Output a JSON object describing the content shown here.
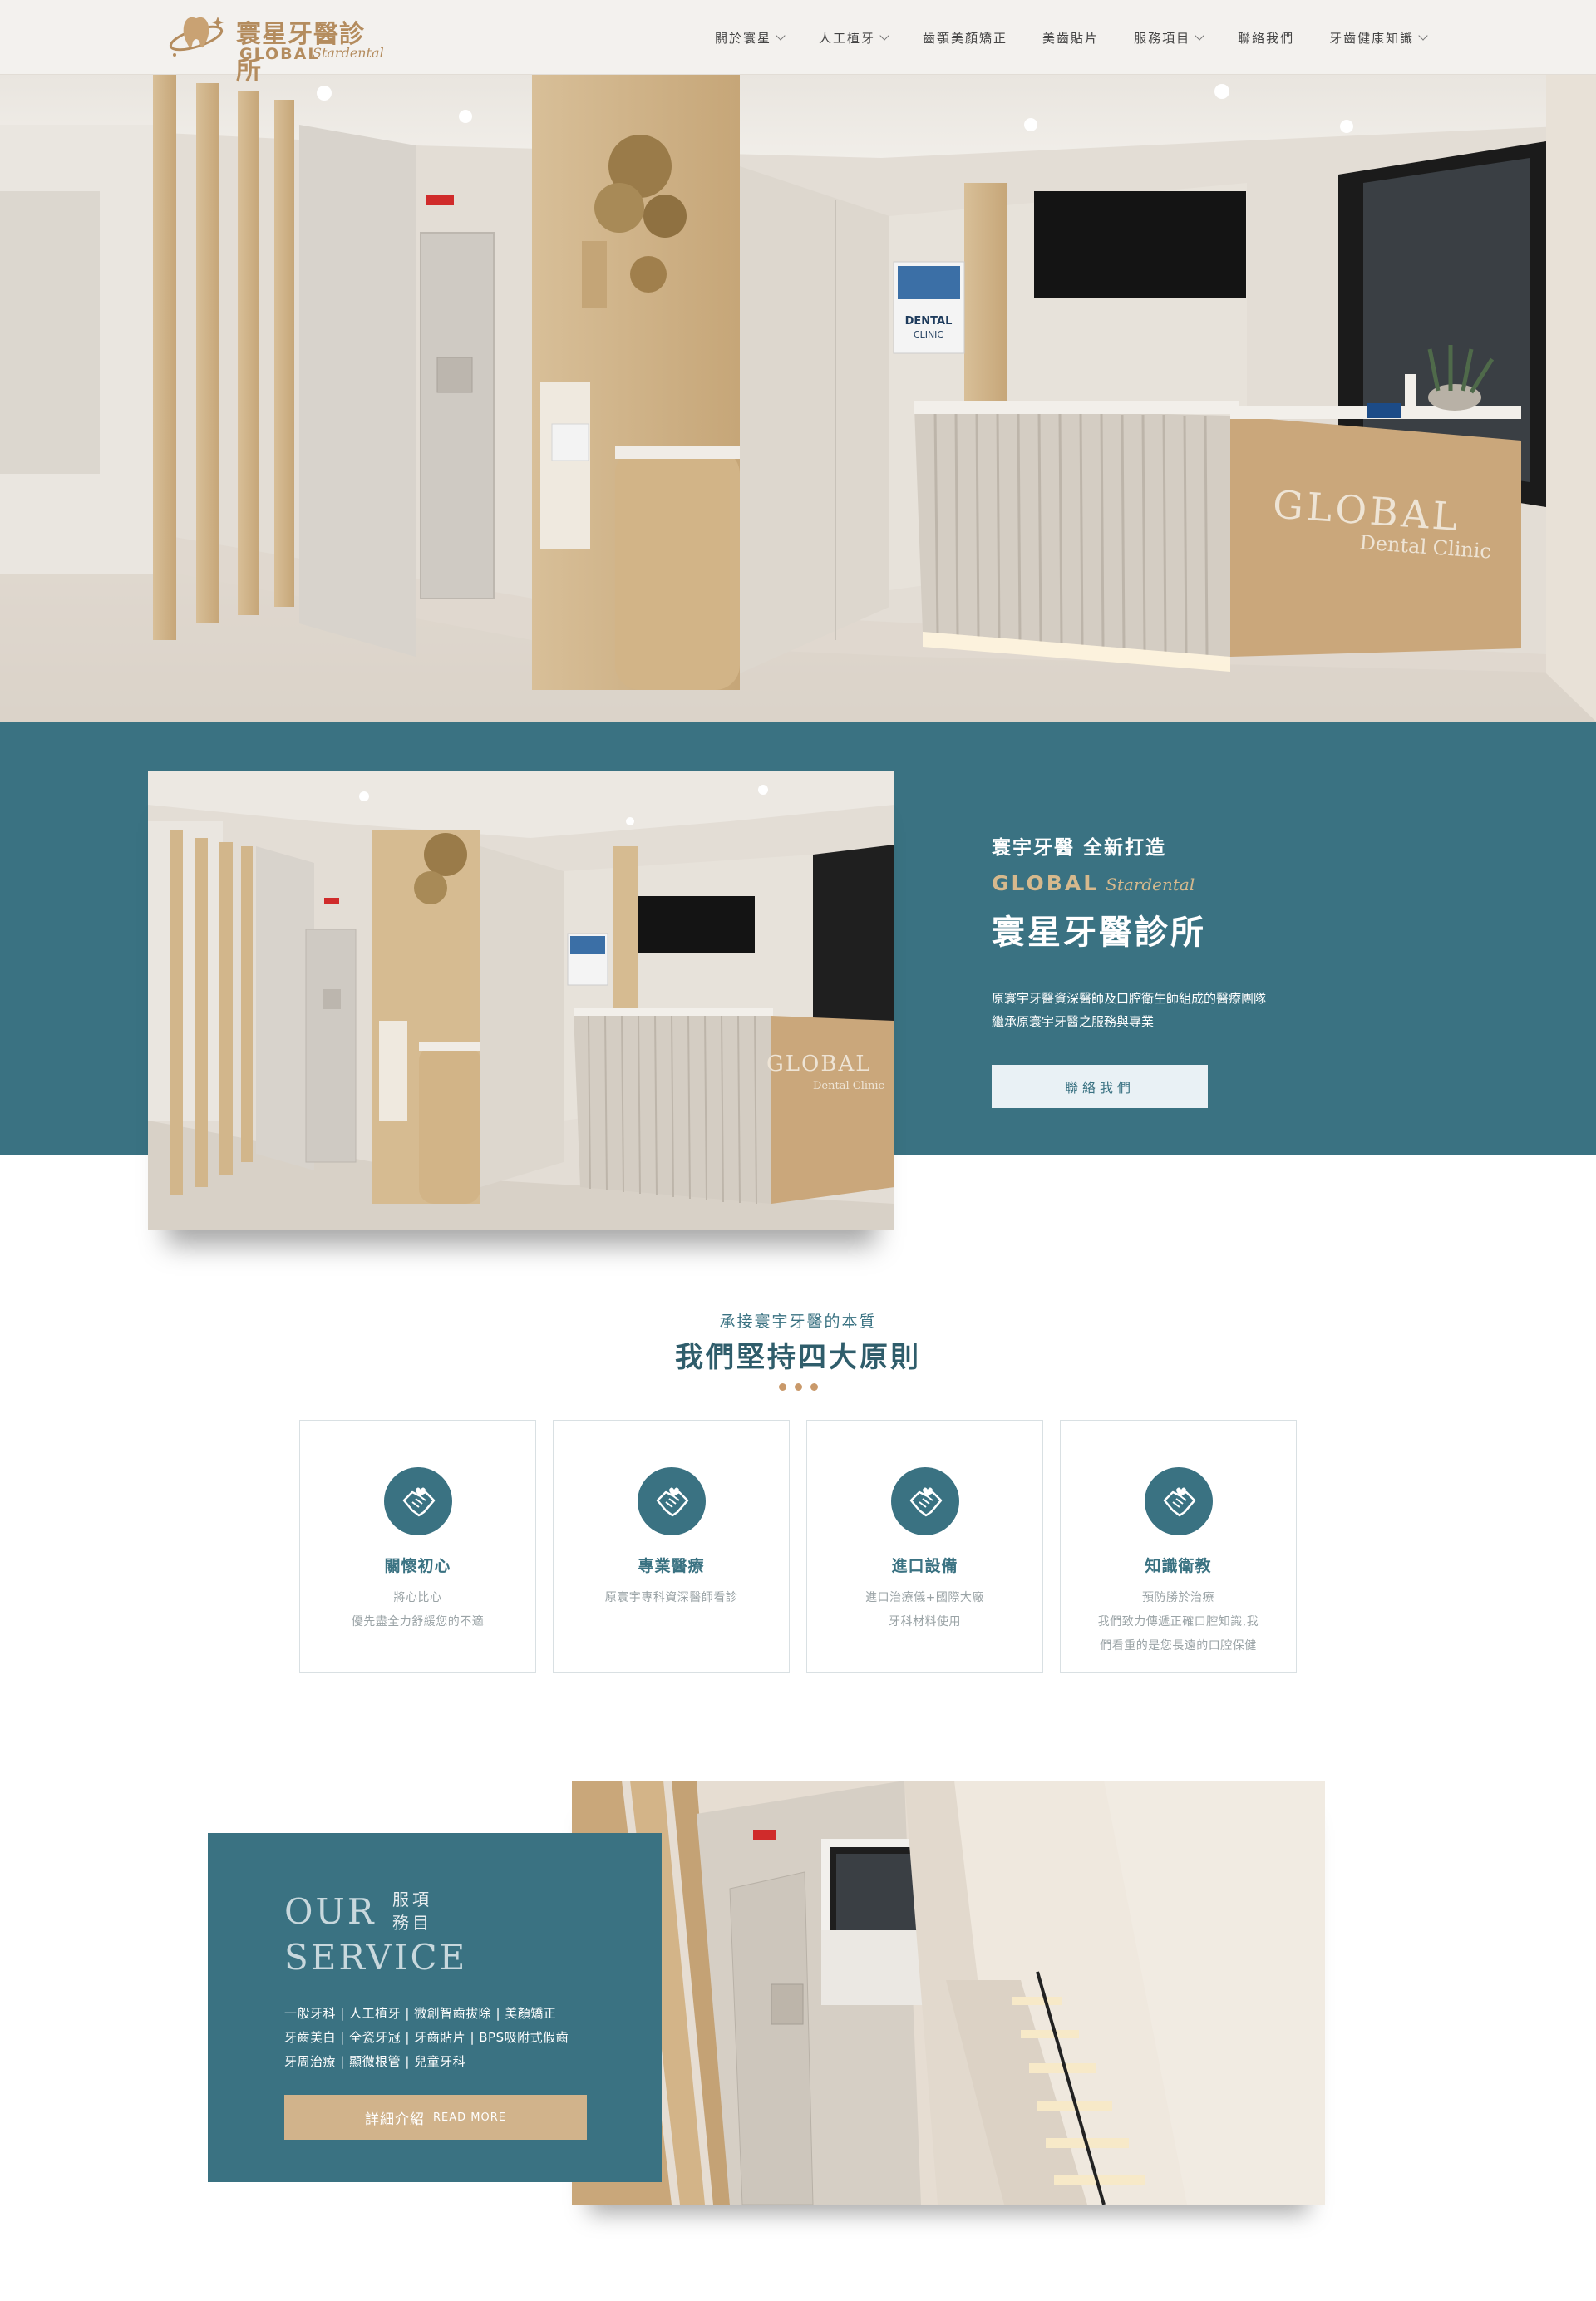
{
  "header": {
    "logo_cn": "寰星牙醫診所",
    "logo_en": "GLOBAL",
    "logo_script": "Stardental",
    "nav": [
      {
        "label": "關於寰星",
        "dropdown": true
      },
      {
        "label": "人工植牙",
        "dropdown": true
      },
      {
        "label": "齒顎美顏矯正",
        "dropdown": false
      },
      {
        "label": "美齒貼片",
        "dropdown": false
      },
      {
        "label": "服務項目",
        "dropdown": true
      },
      {
        "label": "聯絡我們",
        "dropdown": false
      },
      {
        "label": "牙齒健康知識",
        "dropdown": true
      }
    ]
  },
  "hero": {
    "sign_main": "GLOBAL",
    "sign_sub": "Dental Clinic",
    "poster_title": "DENTAL",
    "poster_sub": "CLINIC"
  },
  "intro": {
    "subtitle": "寰宇牙醫 全新打造",
    "brand_en": "GLOBAL",
    "brand_script": "Stardental",
    "title": "寰星牙醫診所",
    "desc_line1": "原寰宇牙醫資深醫師及口腔衛生師組成的醫療團隊",
    "desc_line2": "繼承原寰宇牙醫之服務與專業",
    "button": "聯絡我們"
  },
  "principles": {
    "subtitle": "承接寰宇牙醫的本質",
    "title": "我們堅持四大原則",
    "cards": [
      {
        "icon": "handshake-heart-icon",
        "title": "關懷初心",
        "lines": [
          "將心比心",
          "優先盡全力舒緩您的不適"
        ]
      },
      {
        "icon": "handshake-heart-icon",
        "title": "專業醫療",
        "lines": [
          "原寰宇專科資深醫師看診"
        ]
      },
      {
        "icon": "handshake-heart-icon",
        "title": "進口設備",
        "lines": [
          "進口治療儀+國際大廠",
          "牙科材料使用"
        ]
      },
      {
        "icon": "handshake-heart-icon",
        "title": "知識衛教",
        "lines": [
          "預防勝於治療",
          "我們致力傳遞正確口腔知識,我",
          "們看重的是您長遠的口腔保健"
        ]
      }
    ]
  },
  "service": {
    "our": "OUR",
    "service_word": "SERVICE",
    "cn_top": "服項",
    "cn_bottom": "務目",
    "lines": [
      "一般牙科 | 人工植牙 | 微創智齒拔除 | 美顏矯正",
      "牙齒美白 | 全瓷牙冠 | 牙齒貼片 | BPS吸附式假齒",
      "牙周治療 | 顯微根管 | 兒童牙科"
    ],
    "button_cn": "詳細介紹",
    "button_en": "READ MORE"
  },
  "colors": {
    "teal": "#3a7282",
    "gold": "#b48c5e",
    "beige_button": "#d1b38b"
  }
}
